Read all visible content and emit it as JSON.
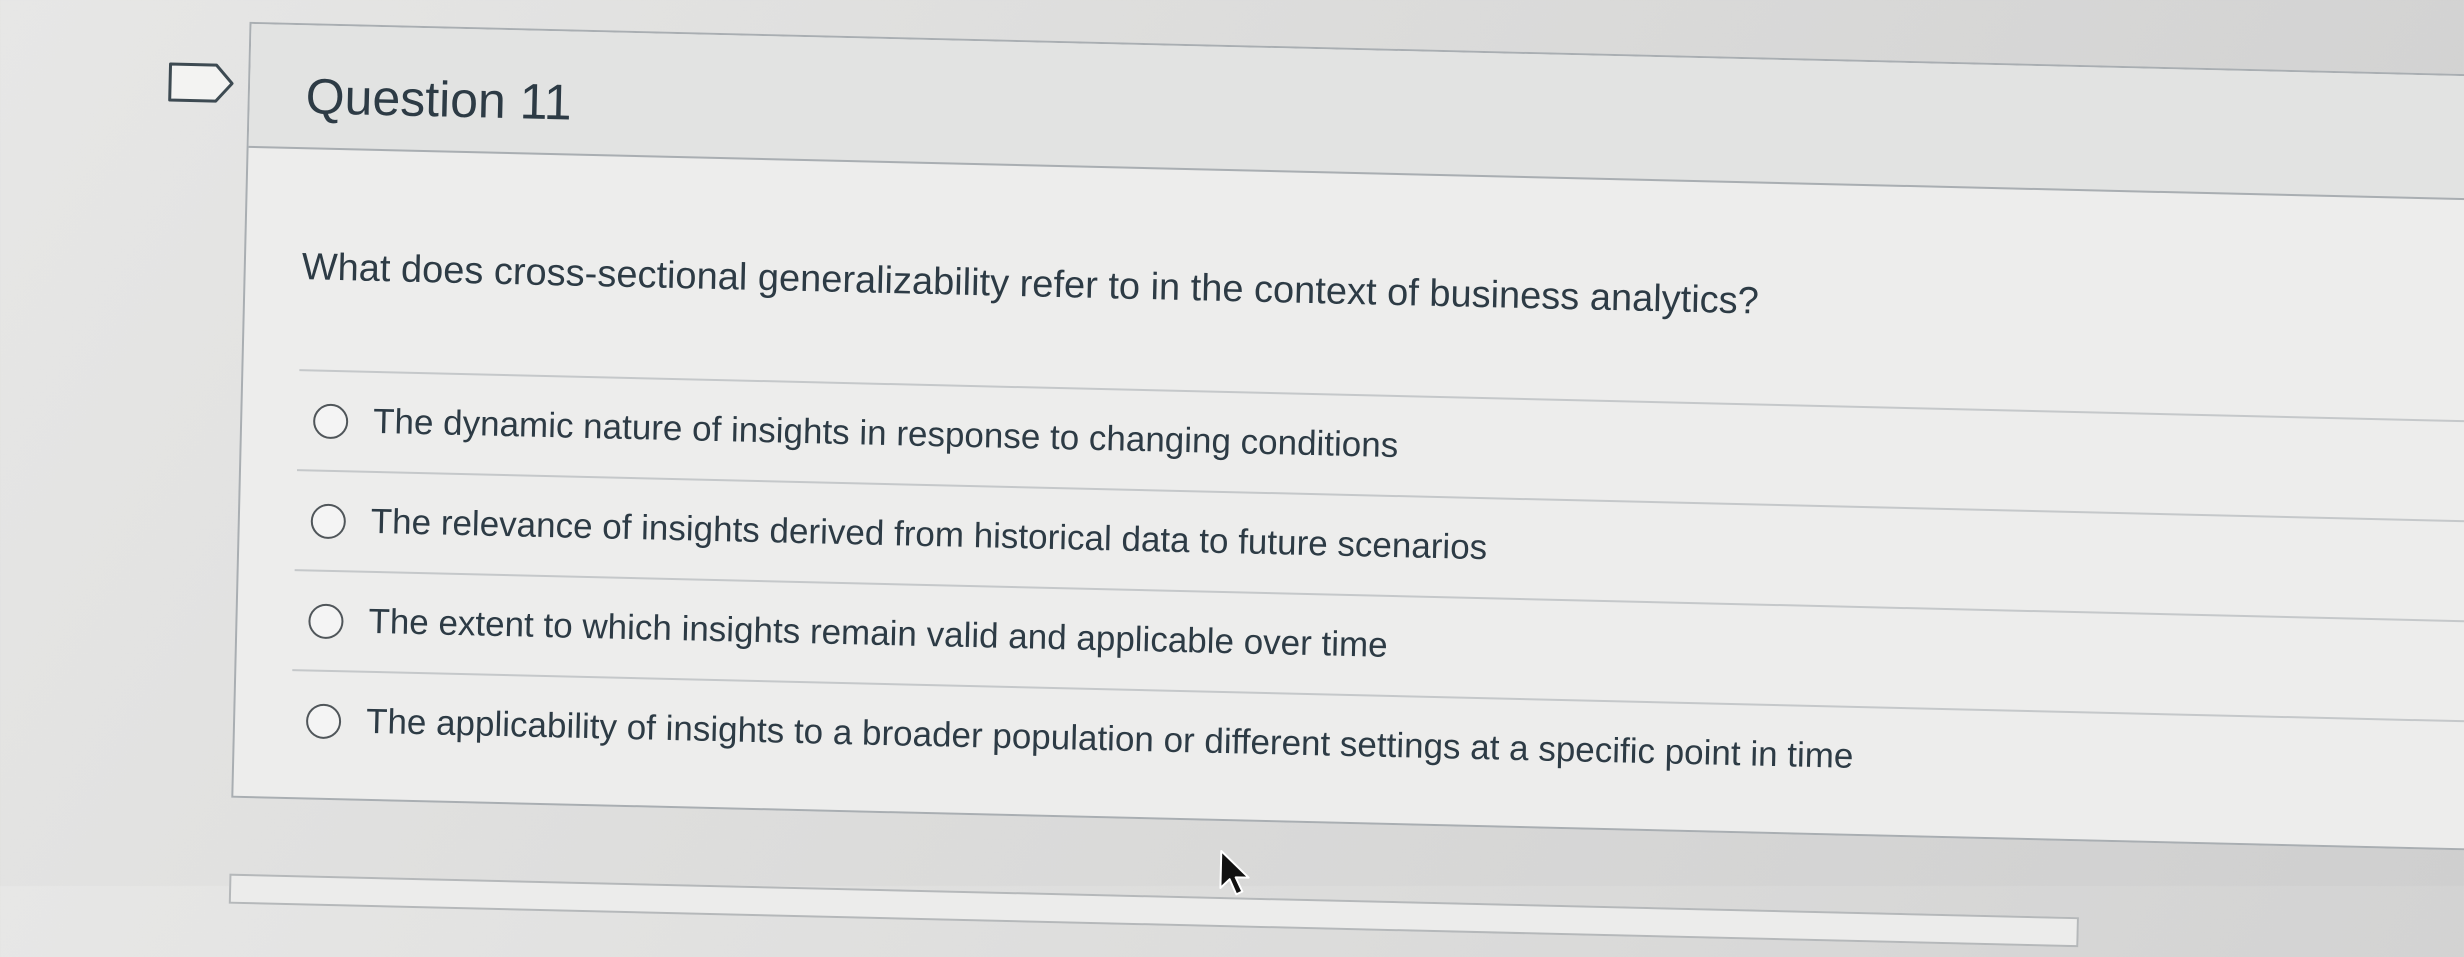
{
  "question": {
    "title": "Question 11",
    "text": "What does cross-sectional generalizability refer to in the context of business analytics?",
    "answers": [
      {
        "label": "The dynamic nature of insights in response to changing conditions"
      },
      {
        "label": "The relevance of insights derived from historical data to future scenarios"
      },
      {
        "label": "The extent to which insights remain valid and applicable over time"
      },
      {
        "label": "The applicability of insights to a broader population or different settings at a specific point in time"
      }
    ]
  },
  "icons": {
    "flag": "flag-icon",
    "radio": "radio-button-icon",
    "cursor": "mouse-cursor-icon"
  },
  "colors": {
    "text": "#2d3b45",
    "border": "#a9aeb2",
    "card_background": "#ededec",
    "header_background": "#e2e3e2"
  }
}
